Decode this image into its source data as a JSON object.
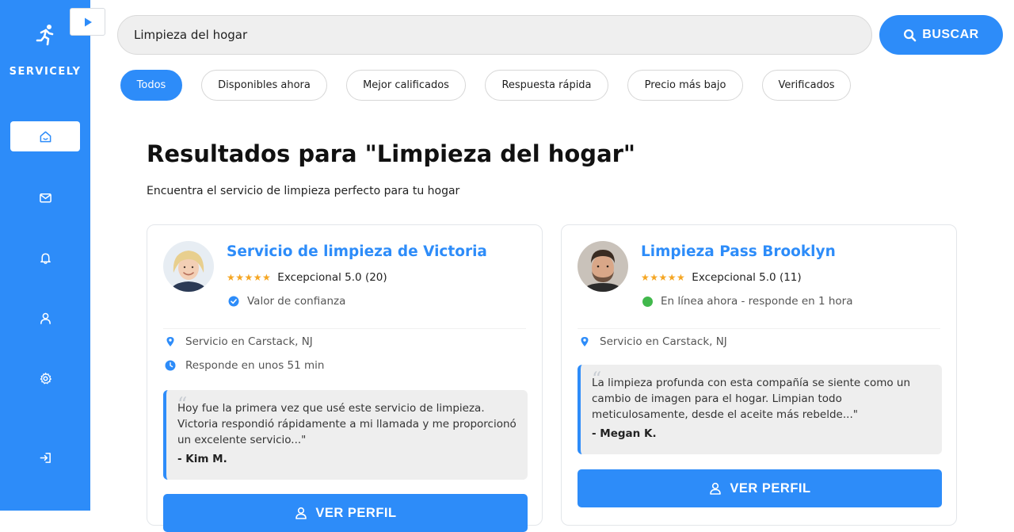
{
  "sidebar": {
    "brand": "SERVICELY",
    "items": [
      {
        "icon": "home-icon",
        "active": true
      },
      {
        "icon": "mail-icon",
        "active": false
      },
      {
        "icon": "bell-icon",
        "active": false
      },
      {
        "icon": "user-icon",
        "active": false
      },
      {
        "icon": "gear-icon",
        "active": false
      },
      {
        "icon": "logout-icon",
        "active": false
      }
    ]
  },
  "search": {
    "value": "Limpieza del hogar",
    "button_label": "BUSCAR"
  },
  "filters": [
    "Todos",
    "Disponibles ahora",
    "Mejor calificados",
    "Respuesta rápida",
    "Precio más bajo",
    "Verificados"
  ],
  "active_filter": "Todos",
  "results": {
    "heading": "Resultados para \"Limpieza del hogar\"",
    "subheading": "Encuentra el servicio de limpieza perfecto para tu hogar"
  },
  "cards": [
    {
      "title": "Servicio de limpieza de Victoria",
      "stars": "★★★★★",
      "rating_text": "Excepcional 5.0 (20)",
      "badge": "Valor de confianza",
      "location": "Servicio en Carstack, NJ",
      "response": "Responde en unos 51 min",
      "quote_mark": "“",
      "quote": "Hoy fue la primera vez que usé este servicio de limpieza. Victoria respondió rápidamente a mi llamada y me proporcionó un excelente servicio...\"",
      "author": "- Kim M.",
      "button_label": "VER PERFIL"
    },
    {
      "title": "Limpieza Pass Brooklyn",
      "stars": "★★★★★",
      "rating_text": "Excepcional 5.0 (11)",
      "badge": "En línea ahora - responde en 1 hora",
      "location": "Servicio en Carstack, NJ",
      "quote_mark": "“",
      "quote": "La limpieza profunda con esta compañía se siente como un cambio de imagen para el hogar. Limpian todo meticulosamente, desde el aceite más rebelde...\"",
      "author": "- Megan K.",
      "button_label": "VER PERFIL"
    }
  ],
  "colors": {
    "primary": "#2d8cf9",
    "star": "#f5a623",
    "online": "#41b84c"
  }
}
